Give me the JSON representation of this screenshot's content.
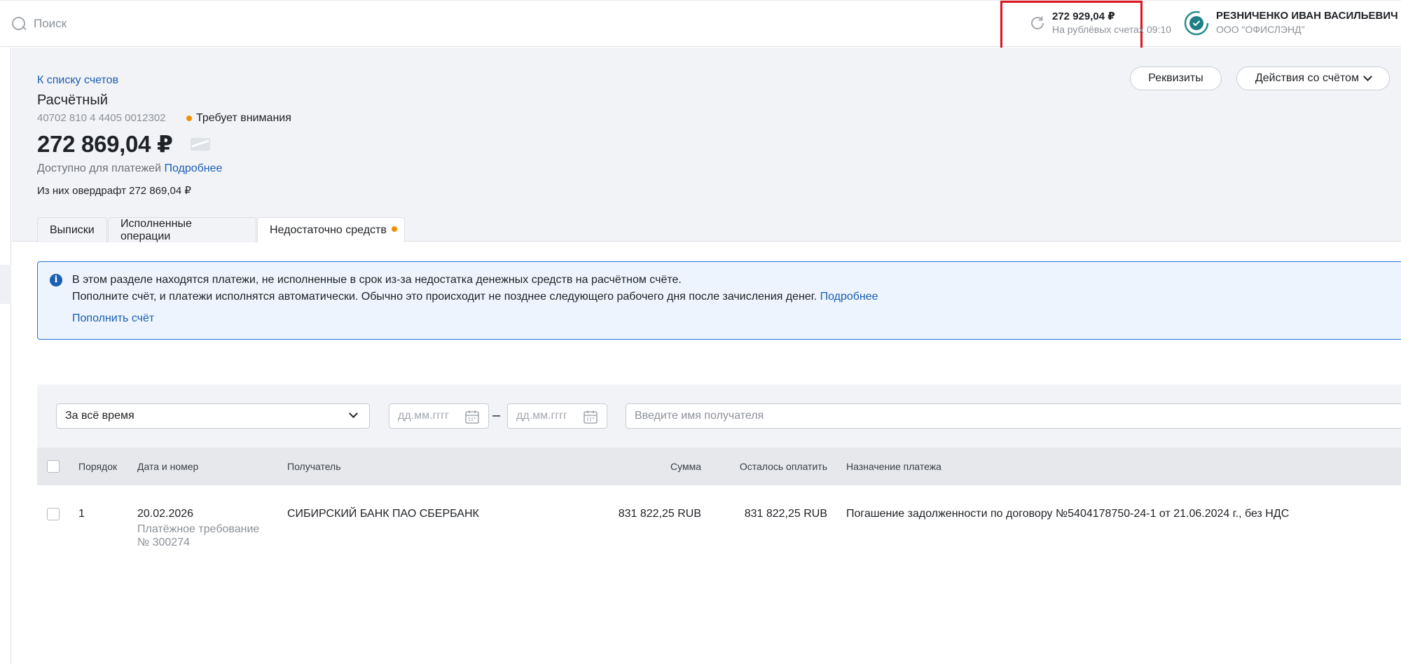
{
  "topbar": {
    "search_placeholder": "Поиск",
    "balance_amount": "272 929,04 ₽",
    "balance_sub": "На рублёвых счетах",
    "balance_time": "09:10",
    "user_name": "РЕЗНИЧЕНКО ИВАН ВАСИЛЬЕВИЧ",
    "user_org": "ООО \"ОФИСЛЭНД\""
  },
  "account": {
    "back_link": "К списку счетов",
    "title": "Расчётный",
    "number": "40702 810 4 4405 0012302",
    "attention": "Требует внимания",
    "balance": "272 869,04 ₽",
    "available_label": "Доступно для платежей",
    "available_link": "Подробнее",
    "overdraft": "Из них овердрафт 272 869,04 ₽",
    "btn_requisites": "Реквизиты",
    "btn_actions": "Действия со счётом"
  },
  "tabs": [
    {
      "label": "Выписки"
    },
    {
      "label": "Исполненные операции"
    },
    {
      "label": "Недостаточно средств"
    }
  ],
  "info": {
    "line1": "В этом разделе находятся платежи, не исполненные в срок из-за недостатка денежных средств на расчётном счёте.",
    "line2": "Пополните счёт, и платежи исполнятся автоматически. Обычно это происходит не позднее следующего рабочего дня после зачисления денег.",
    "line2_link": "Подробнее",
    "topup_link": "Пополнить счёт"
  },
  "filters": {
    "period": "За всё время",
    "date_from_placeholder": "дд.мм.гггг",
    "date_to_placeholder": "дд.мм.гггг",
    "dash": "–",
    "recipient_placeholder": "Введите имя получателя"
  },
  "table": {
    "headers": {
      "order": "Порядок",
      "date": "Дата и номер",
      "recipient": "Получатель",
      "amount": "Сумма",
      "remaining": "Осталось оплатить",
      "purpose": "Назначение платежа"
    },
    "rows": [
      {
        "order": "1",
        "date": "20.02.2026",
        "doc_type": "Платёжное требование",
        "doc_number": "№ 300274",
        "recipient": "СИБИРСКИЙ БАНК ПАО СБЕРБАНК",
        "amount": "831 822,25 RUB",
        "remaining": "831 822,25 RUB",
        "purpose": "Погашение задолженности по договору №5404178750-24-1 от 21.06.2024 г., без НДС"
      }
    ]
  },
  "colors": {
    "accent": "#1a5fb4",
    "attention": "#f29100",
    "highlight_box": "#e0141e"
  }
}
